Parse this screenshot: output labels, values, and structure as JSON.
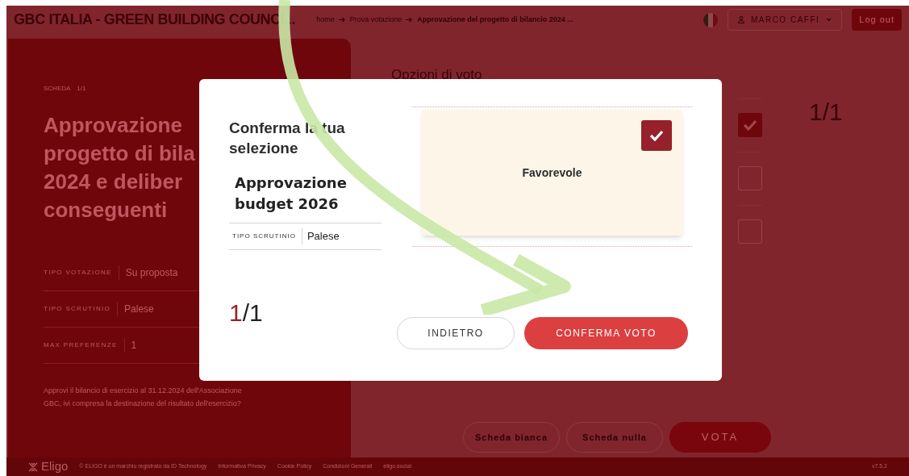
{
  "header": {
    "title": "GBC ITALIA - GREEN BUILDING COUNCI...",
    "breadcrumb": [
      {
        "label": "home",
        "current": false
      },
      {
        "label": "Prova votazione",
        "current": false
      },
      {
        "label": "Approvazione del progetto di bilancio 2024 ...",
        "current": true
      }
    ],
    "user": "MARCO CAFFI",
    "logout": "Log out"
  },
  "ballot": {
    "label": "SCHEDA",
    "index": "1/1",
    "title_lines": [
      "Approvazione",
      "progetto di bila",
      "2024 e deliber",
      "conseguenti"
    ],
    "details": [
      {
        "label": "TIPO VOTAZIONE",
        "value": "Su proposta"
      },
      {
        "label": "TIPO SCRUTINIO",
        "value": "Palese"
      },
      {
        "label": "MAX PREFERENZE",
        "value": "1"
      }
    ],
    "question": "Approvi il bilancio di esercizio al 31.12.2024 dell'Associazione GBC, ivi compresa la destinazione del risultato dell'esercizio?"
  },
  "options": {
    "title": "Opzioni di voto",
    "counter": "1/1",
    "items": [
      {
        "checked": true
      },
      {
        "checked": false
      },
      {
        "checked": false
      }
    ],
    "buttons": [
      "Scheda bianca",
      "Scheda nulla",
      "VOTA"
    ]
  },
  "footer": {
    "brand": "Eligo",
    "links": [
      "© ELIGO è un marchio registrato da ID Technology",
      "Informativa Privacy",
      "Cookie Policy",
      "Condizioni Generali",
      "eligo.social"
    ],
    "version": "v7.5.2"
  },
  "modal": {
    "title": "Conferma la tua selezione",
    "ballot_title": "Approvazione budget 2026",
    "detail": {
      "label": "TIPO SCRUTINIO",
      "value": "Palese"
    },
    "counter_current": "1",
    "counter_total": "/1",
    "choice": {
      "label": "Favorevole",
      "checked": true
    },
    "back": "INDIETRO",
    "confirm": "CONFERMA VOTO"
  }
}
